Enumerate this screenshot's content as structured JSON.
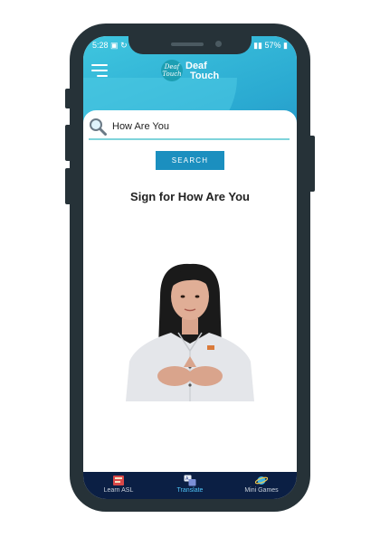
{
  "status_bar": {
    "time": "5:28",
    "battery": "57%"
  },
  "header": {
    "app_name_line1": "Deaf",
    "app_name_line2": "Touch",
    "logo_badge_text": "Deaf Touch"
  },
  "search": {
    "value": "How Are You",
    "placeholder": "",
    "button_label": "SEARCH"
  },
  "result": {
    "title": "Sign for How Are You"
  },
  "bottom_nav": {
    "items": [
      {
        "label": "Learn ASL",
        "icon": "book-icon",
        "active": false
      },
      {
        "label": "Translate",
        "icon": "translate-icon",
        "active": true
      },
      {
        "label": "Mini Games",
        "icon": "planet-icon",
        "active": false
      }
    ]
  },
  "colors": {
    "header": "#2aa9d1",
    "accent": "#1b8fbf",
    "nav_bg": "#0b1f44",
    "active_nav": "#4fc3f7",
    "phone_frame": "#263238"
  }
}
